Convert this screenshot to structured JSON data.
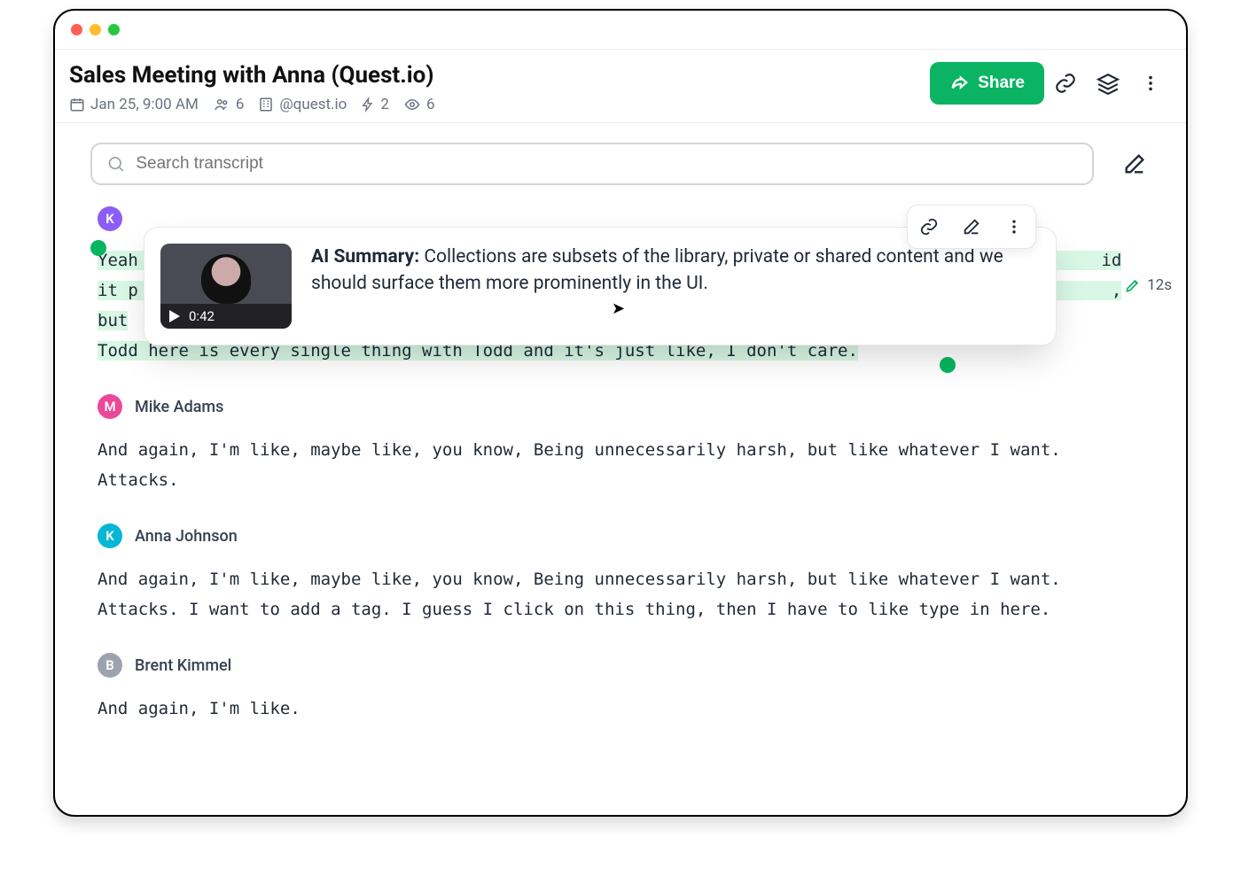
{
  "window": {
    "traffic": [
      "red",
      "yellow",
      "green"
    ]
  },
  "header": {
    "title": "Sales Meeting with Anna (Quest.io)",
    "date": "Jan 25, 9:00 AM",
    "people": "6",
    "org": "@quest.io",
    "moments": "2",
    "views": "6",
    "share_label": "Share"
  },
  "search": {
    "placeholder": "Search transcript"
  },
  "highlight_tag": {
    "duration": "12s"
  },
  "popup": {
    "clip_time": "0:42",
    "summary_label": "AI Summary:",
    "summary_text": "Collections are subsets of the library, private or shared content and we should surface them more prominently in the UI."
  },
  "transcript": [
    {
      "initial": "K",
      "avatar_class": "av-purple",
      "name": "",
      "highlighted": true,
      "lines": [
        "Yeah                                                                                               id",
        "it p                                                                                                ,",
        "but",
        "Todd here is every single thing with Todd and it's just like, I don't care."
      ]
    },
    {
      "initial": "M",
      "avatar_class": "av-pink",
      "name": "Mike Adams",
      "highlighted": false,
      "lines": [
        "And again, I'm like, maybe like, you know, Being unnecessarily harsh, but like whatever I want. Attacks."
      ]
    },
    {
      "initial": "K",
      "avatar_class": "av-cyan",
      "name": "Anna Johnson",
      "highlighted": false,
      "lines": [
        "And again, I'm like, maybe like, you know, Being unnecessarily harsh, but like whatever I want. Attacks. I want to add a tag. I guess I click on this thing, then I have to like type in here."
      ]
    },
    {
      "initial": "B",
      "avatar_class": "av-gray",
      "name": "Brent Kimmel",
      "highlighted": false,
      "lines": [
        "And again, I'm like."
      ]
    }
  ]
}
